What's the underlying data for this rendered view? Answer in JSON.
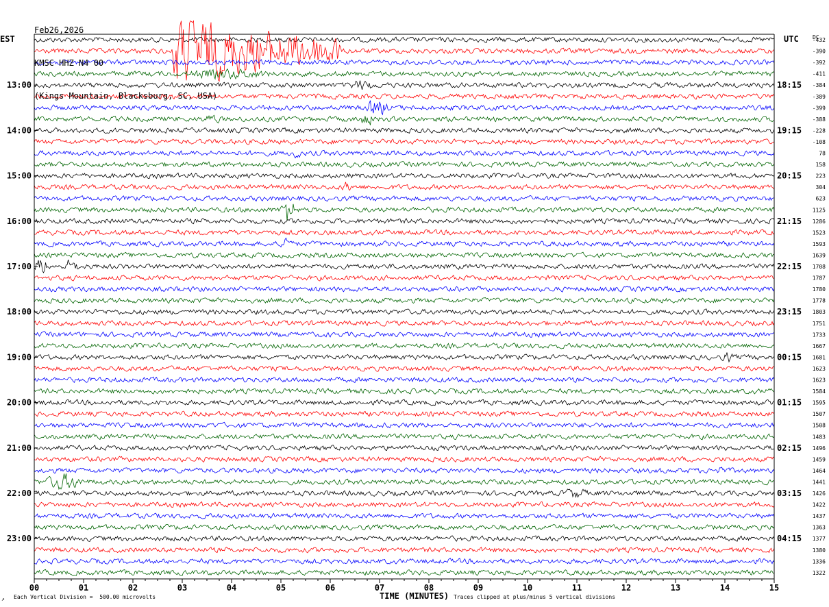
{
  "header": {
    "date": "Feb26,2026",
    "station": "KMSC HHZ N4 00",
    "location": "(Kings Mountain, Blacksburg, SC, USA)"
  },
  "tz_left": "EST",
  "tz_right": "UTC",
  "dc_label": "DC",
  "corner_mark": "↗",
  "footer": {
    "scale": "Each Vertical Division =  500.00 microvolts",
    "xaxis_label": "TIME (MINUTES)",
    "clip_note": "Traces clipped at plus/minus 5 vertical divisions"
  },
  "chart_data": {
    "type": "line",
    "subtype": "helicorder",
    "x": {
      "label": "TIME (MINUTES)",
      "range": [
        0,
        15
      ],
      "ticks": [
        "00",
        "01",
        "02",
        "03",
        "04",
        "05",
        "06",
        "07",
        "08",
        "09",
        "10",
        "11",
        "12",
        "13",
        "14",
        "15"
      ]
    },
    "left_hour_labels": [
      "13:00",
      "14:00",
      "15:00",
      "16:00",
      "17:00",
      "18:00",
      "19:00",
      "20:00",
      "21:00",
      "22:00",
      "23:00"
    ],
    "right_hour_labels": [
      "18:15",
      "19:15",
      "20:15",
      "21:15",
      "22:15",
      "23:15",
      "00:15",
      "01:15",
      "02:15",
      "03:15",
      "04:15"
    ],
    "dc_offsets": [
      "-432",
      "-390",
      "-392",
      "-411",
      "-384",
      "-389",
      "-399",
      "-388",
      "-228",
      "-108",
      "78",
      "158",
      "223",
      "304",
      "623",
      "1125",
      "1286",
      "1523",
      "1593",
      "1639",
      "1708",
      "1787",
      "1780",
      "1778",
      "1803",
      "1751",
      "1733",
      "1667",
      "1681",
      "1623",
      "1623",
      "1584",
      "1595",
      "1507",
      "1508",
      "1483",
      "1496",
      "1459",
      "1464",
      "1441",
      "1426",
      "1422",
      "1437",
      "1363",
      "1377",
      "1380",
      "1336",
      "1322"
    ],
    "trace_colors": [
      "#000000",
      "#ff0000",
      "#0000ff",
      "#006400"
    ],
    "traces_per_hour": 4,
    "trace_count": 48,
    "clip_divisions": 5,
    "events": [
      {
        "trace": 1,
        "start_min": 2.8,
        "end_min": 6.2,
        "amp": 6,
        "kind": "large"
      },
      {
        "trace": 3,
        "start_min": 2.8,
        "end_min": 5.0,
        "amp": 1.5,
        "kind": "coda"
      },
      {
        "trace": 4,
        "start_min": 6.3,
        "end_min": 7.0,
        "amp": 1.6,
        "kind": "burst"
      },
      {
        "trace": 6,
        "start_min": 6.7,
        "end_min": 7.2,
        "amp": 2.5,
        "kind": "burst"
      },
      {
        "trace": 7,
        "start_min": 3.4,
        "end_min": 3.8,
        "amp": 1.5,
        "kind": "burst"
      },
      {
        "trace": 7,
        "start_min": 6.5,
        "end_min": 7.0,
        "amp": 1.8,
        "kind": "burst"
      },
      {
        "trace": 10,
        "start_min": 5.2,
        "end_min": 5.4,
        "amp": 2.0,
        "kind": "burst"
      },
      {
        "trace": 13,
        "start_min": 6.2,
        "end_min": 6.5,
        "amp": 1.6,
        "kind": "burst"
      },
      {
        "trace": 15,
        "start_min": 5.0,
        "end_min": 5.3,
        "amp": 4.5,
        "kind": "burst"
      },
      {
        "trace": 18,
        "start_min": 5.0,
        "end_min": 5.2,
        "amp": 3.0,
        "kind": "burst"
      },
      {
        "trace": 20,
        "start_min": 0.0,
        "end_min": 0.3,
        "amp": 2.5,
        "kind": "burst"
      },
      {
        "trace": 20,
        "start_min": 0.6,
        "end_min": 0.9,
        "amp": 2.5,
        "kind": "burst"
      },
      {
        "trace": 28,
        "start_min": 13.9,
        "end_min": 14.2,
        "amp": 1.6,
        "kind": "burst"
      },
      {
        "trace": 38,
        "start_min": 13.8,
        "end_min": 14.0,
        "amp": 1.6,
        "kind": "burst"
      },
      {
        "trace": 39,
        "start_min": 0.2,
        "end_min": 1.0,
        "amp": 2.5,
        "kind": "burst"
      },
      {
        "trace": 40,
        "start_min": 10.6,
        "end_min": 11.3,
        "amp": 1.5,
        "kind": "burst"
      }
    ]
  }
}
